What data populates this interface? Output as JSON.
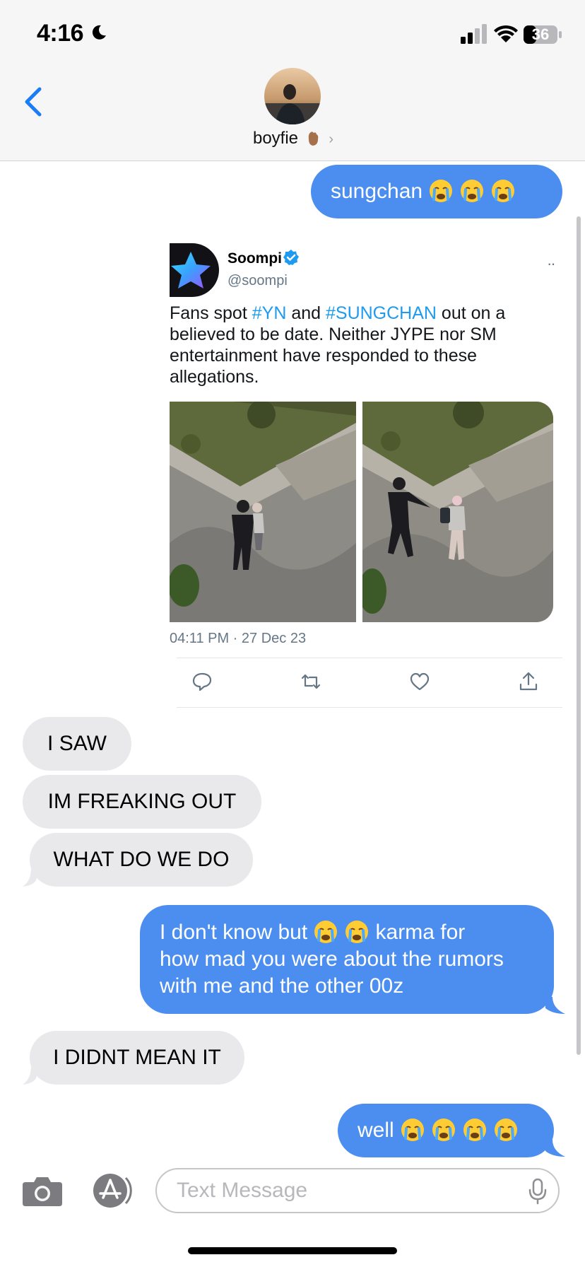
{
  "status_bar": {
    "time": "4:16",
    "battery": "36",
    "icons": [
      "moon-icon",
      "cellular-signal-icon",
      "wifi-icon",
      "battery-icon"
    ]
  },
  "header": {
    "contact_name": "boyfie",
    "contact_emoji": "hand-emoji",
    "back_icon": "chevron-left-icon",
    "detail_icon": "chevron-right-icon",
    "chevron": "›"
  },
  "messages": {
    "m1": "sungchan",
    "m2": "I SAW",
    "m3": "IM FREAKING OUT",
    "m4": "WHAT DO WE DO",
    "m5_a": "I don't know but",
    "m5_b": "karma for",
    "m5_c": "how mad you were about the rumors",
    "m5_d": "with me and the other 00z",
    "m6": "I DIDNT MEAN IT",
    "m7": "well"
  },
  "tweet": {
    "name": "Soompi",
    "handle": "@soompi",
    "more": "··",
    "text_l1_pre": "Fans spot ",
    "tag1": "#YN",
    "text_l1_mid": " and ",
    "tag2": "#SUNGCHAN",
    "text_l1_post": " out on a",
    "text_l2": "believed to be date. Neither JYPE nor SM",
    "text_l3": "entertainment have responded to these",
    "text_l4": "allegations.",
    "timestamp": "04:11 PM · 27 Dec 23",
    "actions": [
      "reply-icon",
      "retweet-icon",
      "like-icon",
      "share-icon"
    ]
  },
  "compose": {
    "placeholder": "Text Message",
    "icons": [
      "camera-icon",
      "app-store-icon",
      "microphone-icon"
    ]
  },
  "colors": {
    "sent_bubble": "#4b8ef0",
    "received_bubble": "#e9e9eb",
    "ios_blue": "#1a7cf6",
    "twitter_blue": "#1d9bf0"
  }
}
